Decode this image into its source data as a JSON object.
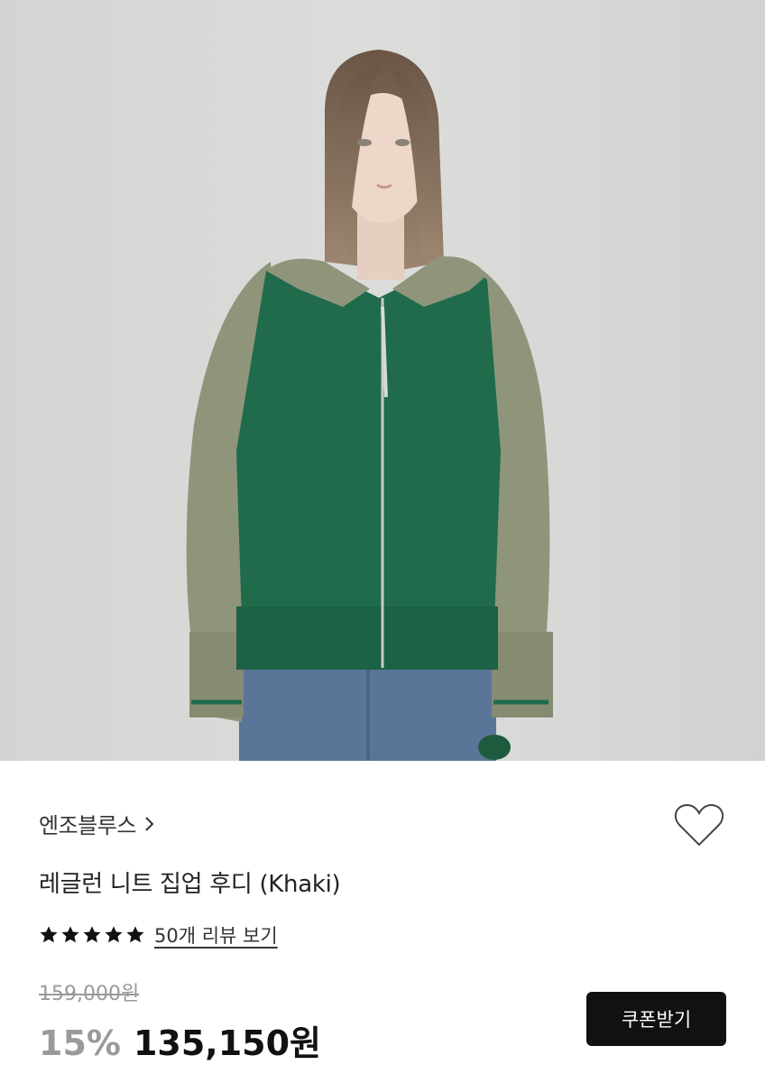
{
  "product": {
    "image": {
      "icon": "product-photo",
      "colors": {
        "background": "#d9dad8",
        "body_knit": "#1f6b4c",
        "sleeves": "#8e957b",
        "denim": "#5a7597"
      }
    },
    "brand": {
      "name": "엔조블루스",
      "chevron_icon": "chevron-right-icon"
    },
    "wishlist": {
      "icon": "heart-outline-icon"
    },
    "title": "레글런 니트 집업 후디 (Khaki)",
    "rating": {
      "stars": 5,
      "max_stars": 5,
      "star_icon": "star-filled-icon",
      "review_link": "50개 리뷰 보기"
    },
    "price": {
      "original": "159,000원",
      "discount": "15%",
      "sale": "135,150원"
    },
    "coupon_button": "쿠폰받기",
    "colors": {
      "accent": "#111111",
      "muted": "#9a9a9a",
      "strike": "#999999"
    }
  }
}
